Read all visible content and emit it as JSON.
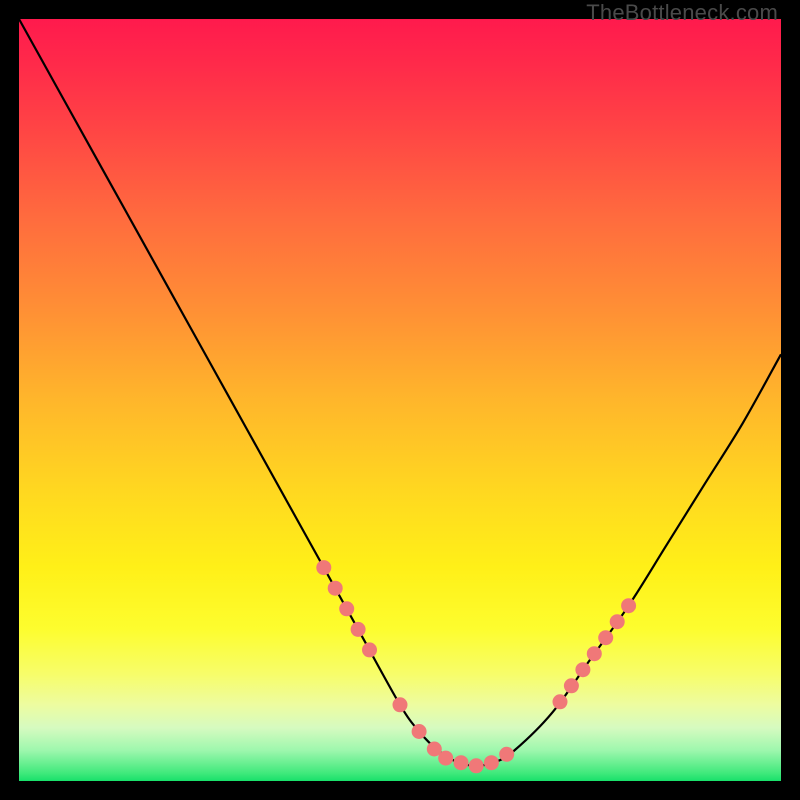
{
  "watermark": "TheBottleneck.com",
  "colors": {
    "background": "#000000",
    "curve": "#000000",
    "marker": "#f07878",
    "gradient_top": "#ff1a4d",
    "gradient_bottom": "#18e06a"
  },
  "chart_data": {
    "type": "line",
    "title": "",
    "xlabel": "",
    "ylabel": "",
    "xlim": [
      0,
      100
    ],
    "ylim": [
      0,
      100
    ],
    "series": [
      {
        "name": "bottleneck-curve",
        "x": [
          0,
          5,
          10,
          15,
          20,
          25,
          30,
          35,
          40,
          45,
          50,
          52.5,
          55,
          57.5,
          60,
          62.5,
          65,
          70,
          75,
          80,
          85,
          90,
          95,
          100
        ],
        "values": [
          100,
          91,
          82,
          73,
          64,
          55,
          46,
          37,
          28,
          19,
          10,
          6.5,
          4,
          2.5,
          2,
          2.5,
          4,
          9,
          16,
          23,
          31,
          39,
          47,
          56
        ]
      }
    ],
    "markers": [
      {
        "x": 40.0,
        "y": 28.0
      },
      {
        "x": 41.5,
        "y": 25.3
      },
      {
        "x": 43.0,
        "y": 22.6
      },
      {
        "x": 44.5,
        "y": 19.9
      },
      {
        "x": 46.0,
        "y": 17.2
      },
      {
        "x": 50.0,
        "y": 10.0
      },
      {
        "x": 52.5,
        "y": 6.5
      },
      {
        "x": 54.5,
        "y": 4.2
      },
      {
        "x": 56.0,
        "y": 3.0
      },
      {
        "x": 58.0,
        "y": 2.4
      },
      {
        "x": 60.0,
        "y": 2.0
      },
      {
        "x": 62.0,
        "y": 2.4
      },
      {
        "x": 64.0,
        "y": 3.5
      },
      {
        "x": 71.0,
        "y": 10.4
      },
      {
        "x": 72.5,
        "y": 12.5
      },
      {
        "x": 74.0,
        "y": 14.6
      },
      {
        "x": 75.5,
        "y": 16.7
      },
      {
        "x": 77.0,
        "y": 18.8
      },
      {
        "x": 78.5,
        "y": 20.9
      },
      {
        "x": 80.0,
        "y": 23.0
      }
    ]
  }
}
